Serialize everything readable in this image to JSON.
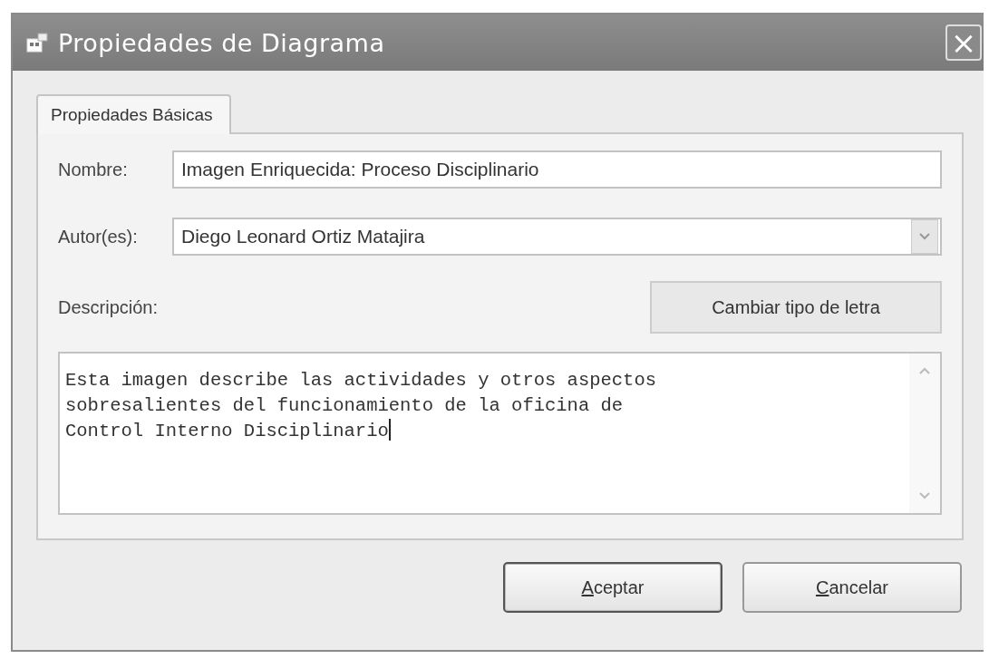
{
  "window": {
    "title": "Propiedades de Diagrama",
    "close": "×"
  },
  "tabs": [
    {
      "label": "Propiedades Básicas",
      "selected": true
    }
  ],
  "fields": [
    {
      "kind": "text",
      "label": "Nombre:",
      "value": "Imagen Enriquecida: Proceso Disciplinario"
    },
    {
      "kind": "combo",
      "label": "Autor(es):",
      "value": "Diego Leonard Ortiz Matajira"
    }
  ],
  "description": {
    "label": "Descripción:",
    "font_button": "Cambiar tipo de letra",
    "lines": [
      "Esta imagen describe las actividades y otros aspectos",
      "sobresalientes del funcionamiento de la oficina de",
      "Control Interno Disciplinario"
    ]
  },
  "buttons": [
    {
      "mnemonic": "A",
      "label_rest": "ceptar",
      "default": true
    },
    {
      "mnemonic": "C",
      "label_rest": "ancelar",
      "default": false
    }
  ]
}
